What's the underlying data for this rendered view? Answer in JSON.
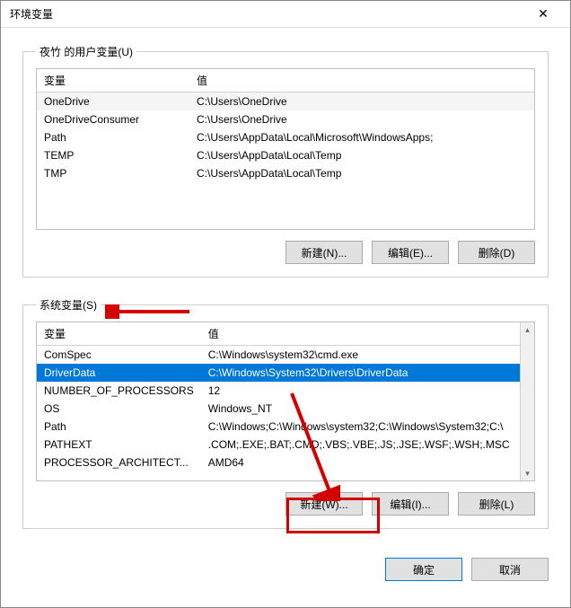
{
  "window": {
    "title": "环境变量",
    "close_label": "✕"
  },
  "user_section": {
    "legend": "夜竹 的用户变量(U)",
    "columns": {
      "var": "变量",
      "val": "值"
    },
    "rows": [
      {
        "var": "OneDrive",
        "val": "C:\\Users\\OneDrive"
      },
      {
        "var": "OneDriveConsumer",
        "val": "C:\\Users\\OneDrive"
      },
      {
        "var": "Path",
        "val": "C:\\Users\\AppData\\Local\\Microsoft\\WindowsApps;"
      },
      {
        "var": "TEMP",
        "val": "C:\\Users\\AppData\\Local\\Temp"
      },
      {
        "var": "TMP",
        "val": "C:\\Users\\AppData\\Local\\Temp"
      }
    ],
    "buttons": {
      "new": "新建(N)...",
      "edit": "编辑(E)...",
      "delete": "删除(D)"
    }
  },
  "system_section": {
    "legend": "系统变量(S)",
    "columns": {
      "var": "变量",
      "val": "值"
    },
    "rows": [
      {
        "var": "ComSpec",
        "val": "C:\\Windows\\system32\\cmd.exe"
      },
      {
        "var": "DriverData",
        "val": "C:\\Windows\\System32\\Drivers\\DriverData",
        "selected": true
      },
      {
        "var": "NUMBER_OF_PROCESSORS",
        "val": "12"
      },
      {
        "var": "OS",
        "val": "Windows_NT"
      },
      {
        "var": "Path",
        "val": "C:\\Windows;C:\\Windows\\system32;C:\\Windows\\System32;C:\\"
      },
      {
        "var": "PATHEXT",
        "val": ".COM;.EXE;.BAT;.CMD;.VBS;.VBE;.JS;.JSE;.WSF;.WSH;.MSC"
      },
      {
        "var": "PROCESSOR_ARCHITECT...",
        "val": "AMD64"
      }
    ],
    "buttons": {
      "new": "新建(W)...",
      "edit": "编辑(I)...",
      "delete": "删除(L)"
    }
  },
  "dialog_buttons": {
    "ok": "确定",
    "cancel": "取消"
  },
  "scroll": {
    "up": "▴",
    "down": "▾"
  }
}
